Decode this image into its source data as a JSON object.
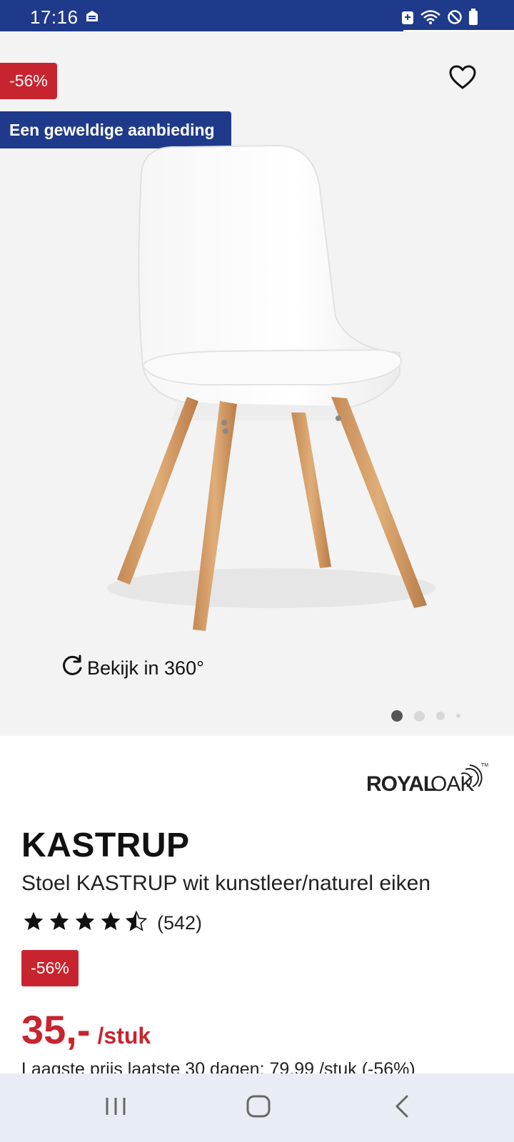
{
  "status_bar": {
    "time": "17:16",
    "icons": [
      "app-notification-icon",
      "vpn-shield-icon",
      "wifi-icon",
      "do-not-disturb-icon",
      "battery-icon"
    ]
  },
  "gallery": {
    "discount_badge": "-56%",
    "deal_badge": "Een geweldige aanbieding",
    "view_360_label": "Bekijk in 360°",
    "image_count": 4,
    "active_image_index": 0
  },
  "product": {
    "brand": "ROYALOAK",
    "name": "KASTRUP",
    "description": "Stoel KASTRUP wit kunstleer/naturel eiken",
    "rating_stars": 4.5,
    "rating_count": "(542)",
    "discount_badge": "-56%",
    "price": "35,-",
    "price_unit": "/stuk",
    "lowest_price_note": "Laagste prijs laatste 30 dagen: 79,99 /stuk (-56%)"
  },
  "colors": {
    "accent_blue": "#1f3a8a",
    "discount_red": "#c8242f",
    "gallery_bg": "#f3f3f3"
  }
}
